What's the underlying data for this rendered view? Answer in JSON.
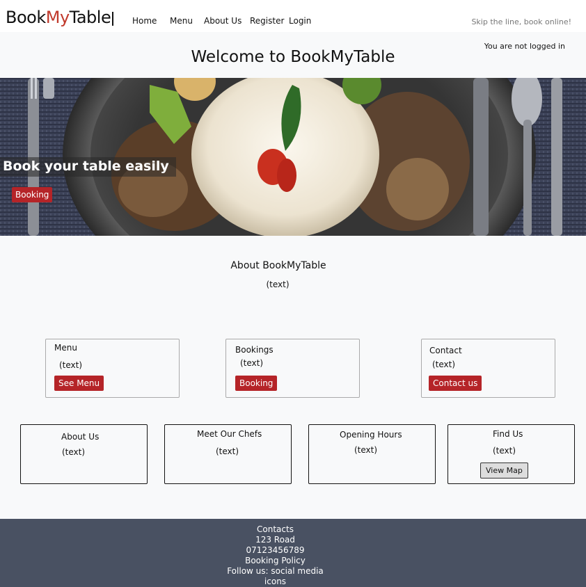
{
  "brand": {
    "part1": "Book",
    "part2": "My",
    "part3": "Table"
  },
  "nav": {
    "home": "Home",
    "menu": "Menu",
    "about": "About Us",
    "register": "Register",
    "login": "Login"
  },
  "tagline": "Skip the line, book online!",
  "login_status": "You are not logged in",
  "welcome": "Welcome to BookMyTable",
  "hero": {
    "title": "Book your table easily",
    "button": "Booking"
  },
  "about": {
    "title": "About BookMyTable",
    "text": "(text)"
  },
  "cards": [
    {
      "title": "Menu",
      "text": "(text)",
      "button": "See Menu"
    },
    {
      "title": "Bookings",
      "text": "(text)",
      "button": "Booking"
    },
    {
      "title": "Contact",
      "text": "(text)",
      "button": "Contact us"
    }
  ],
  "boxes": [
    {
      "title": "About Us",
      "text": "(text)"
    },
    {
      "title": "Meet Our Chefs",
      "text": "(text)"
    },
    {
      "title": "Opening Hours",
      "text": "(text)"
    },
    {
      "title": "Find Us",
      "text": "(text)",
      "button": "View Map"
    }
  ],
  "footer": {
    "contacts": "Contacts",
    "address": "123 Road",
    "phone": "07123456789",
    "policy": "Booking Policy",
    "social": "Follow us: social media icons"
  },
  "colors": {
    "accent": "#b52428",
    "brand_accent": "#c0392b",
    "footer_bg": "#495162",
    "page_bg": "#f8f9fa"
  }
}
